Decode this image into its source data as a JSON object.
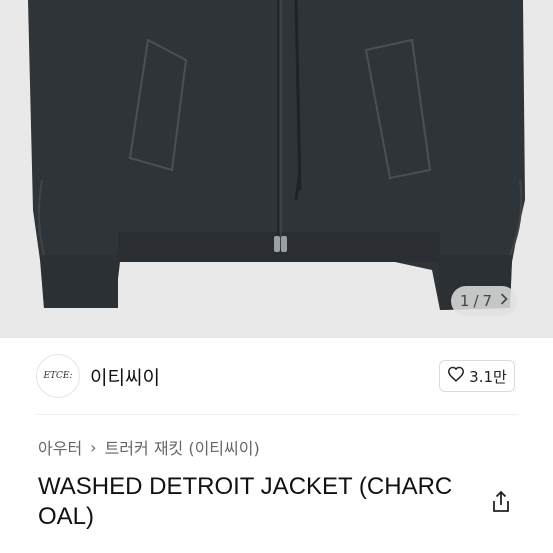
{
  "gallery": {
    "current": "1",
    "separator": "/",
    "total": "7",
    "next_icon": "chevron-right-icon"
  },
  "brand": {
    "logo_text": "ETCE:",
    "name": "이티씨이"
  },
  "like": {
    "count": "3.1만",
    "icon": "heart-outline-icon"
  },
  "breadcrumb": {
    "category": "아우터",
    "separator": "›",
    "subcategory": "트러커 재킷 (이티씨이)"
  },
  "product": {
    "title": "WASHED DETROIT JACKET (CHARCOAL)"
  },
  "share": {
    "icon": "share-icon"
  }
}
